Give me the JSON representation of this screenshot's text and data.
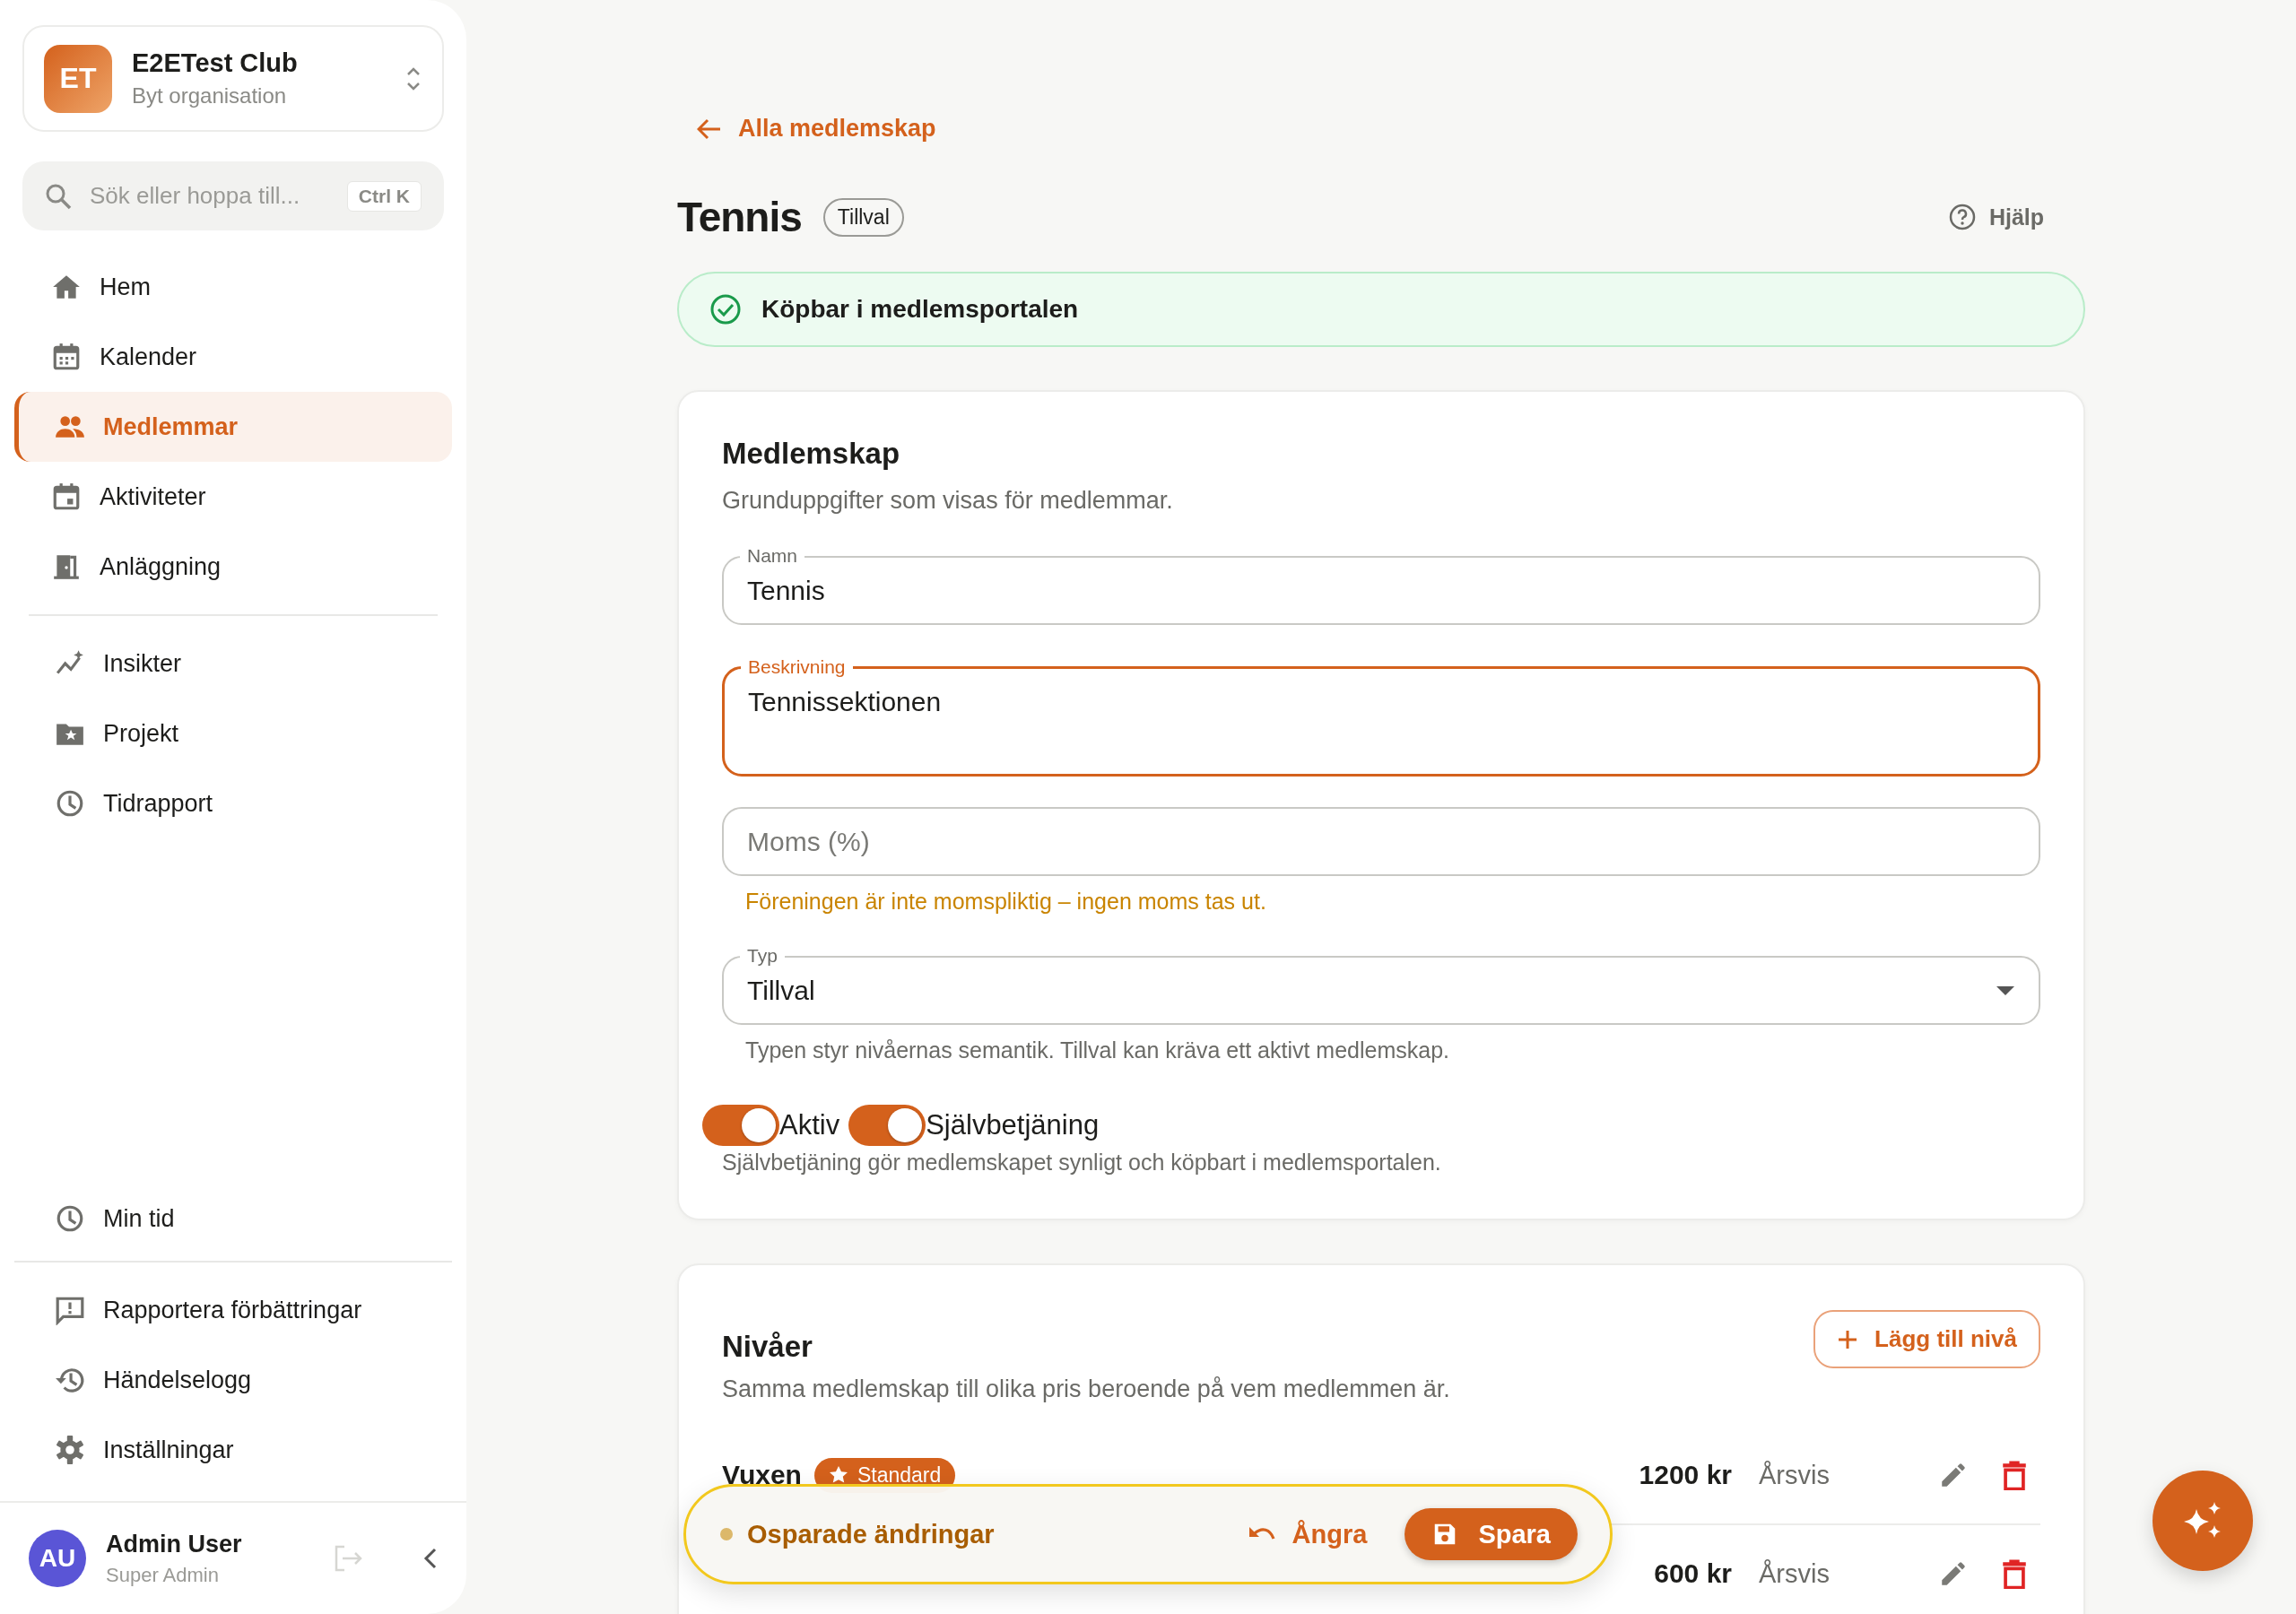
{
  "sidebar": {
    "org": {
      "initials": "ET",
      "name": "E2ETest Club",
      "subtitle": "Byt organisation"
    },
    "search": {
      "placeholder": "Sök eller hoppa till...",
      "shortcut": "Ctrl K"
    },
    "sections": [
      {
        "items": [
          {
            "label": "Hem",
            "selected": false
          },
          {
            "label": "Kalender",
            "selected": false
          },
          {
            "label": "Medlemmar",
            "selected": true
          },
          {
            "label": "Aktiviteter",
            "selected": false
          },
          {
            "label": "Anläggning",
            "selected": false
          }
        ]
      },
      {
        "items": [
          {
            "label": "Insikter",
            "selected": false
          },
          {
            "label": "Projekt",
            "selected": false
          },
          {
            "label": "Tidrapport",
            "selected": false
          }
        ]
      },
      {
        "items": [
          {
            "label": "Min tid",
            "selected": false
          }
        ]
      },
      {
        "items": [
          {
            "label": "Rapportera förbättringar",
            "selected": false
          },
          {
            "label": "Händelselogg",
            "selected": false
          },
          {
            "label": "Inställningar",
            "selected": false
          }
        ]
      }
    ],
    "user": {
      "initials": "AU",
      "name": "Admin User",
      "role": "Super Admin"
    }
  },
  "page": {
    "back_link": "Alla medlemskap",
    "title": "Tennis",
    "type_badge": "Tillval",
    "help": "Hjälp",
    "status_banner": "Köpbar i medlemsportalen"
  },
  "membership": {
    "title": "Medlemskap",
    "subtitle": "Grunduppgifter som visas för medlemmar.",
    "fields": [
      {
        "kind": "text",
        "label": "Namn",
        "value": "Tennis",
        "focused": false
      },
      {
        "kind": "textarea",
        "label": "Beskrivning",
        "value": "Tennissektionen",
        "focused": true
      },
      {
        "kind": "text",
        "placeholder": "Moms (%)",
        "focused": false,
        "helper": "Föreningen är inte momspliktig – ingen moms tas ut.",
        "warning": true
      },
      {
        "kind": "select",
        "label": "Typ",
        "value": "Tillval",
        "focused": false,
        "helper": "Typen styr nivåernas semantik. Tillval kan kräva ett aktivt medlemskap.",
        "warning": false
      }
    ],
    "toggles": [
      {
        "label": "Aktiv",
        "on": true
      },
      {
        "label": "Självbetjäning",
        "on": true
      }
    ],
    "toggle_helper": "Självbetjäning gör medlemskapet synligt och köpbart i medlemsportalen."
  },
  "levels": {
    "title": "Nivåer",
    "subtitle": "Samma medlemskap till olika pris beroende på vem medlemmen är.",
    "add_button": "Lägg till nivå",
    "rows": [
      {
        "name": "Vuxen",
        "badge": "Standard",
        "price": "1200 kr",
        "period": "Årsvis"
      },
      {
        "price": "600 kr",
        "period": "Årsvis"
      }
    ]
  },
  "unsaved_bar": {
    "message": "Osparade ändringar",
    "undo": "Ångra",
    "save": "Spara"
  }
}
